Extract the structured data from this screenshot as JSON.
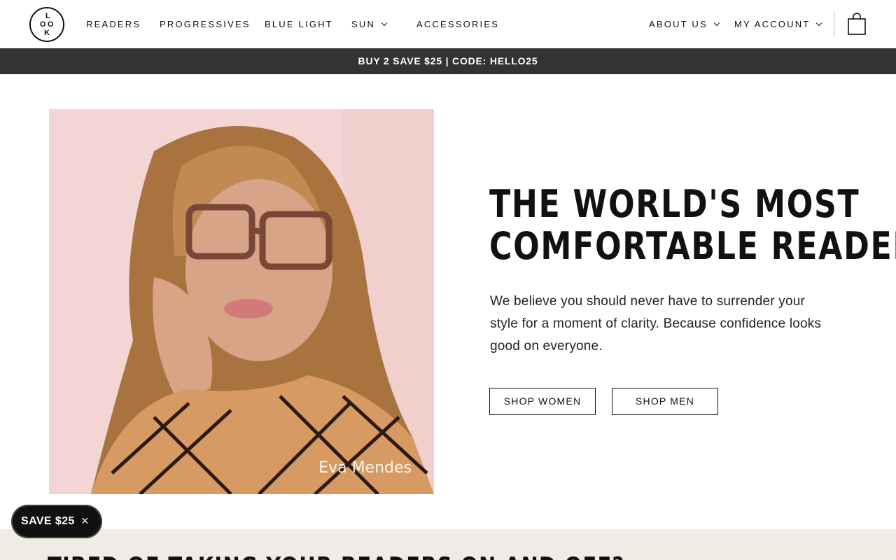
{
  "header": {
    "logo_letters": [
      "L",
      "O",
      "O",
      "K"
    ],
    "nav": [
      {
        "label": "READERS"
      },
      {
        "label": "PROGRESSIVES"
      },
      {
        "label": "BLUE LIGHT"
      },
      {
        "label": "SUN",
        "has_dropdown": true
      },
      {
        "label": "ACCESSORIES"
      }
    ],
    "about_label": "ABOUT US",
    "account_label": "MY ACCOUNT",
    "cart_icon": "shopping-bag-icon"
  },
  "promo": {
    "text": "BUY 2 SAVE $25 | CODE: HELLO25",
    "background": "#333333"
  },
  "hero": {
    "image_caption": "Eva Mendes",
    "headline_line1": "THE WORLD'S MOST",
    "headline_line2": "COMFORTABLE READER",
    "body": "We believe you should never have to surrender your style for a moment of clarity. Because confidence looks good on everyone.",
    "buttons": {
      "women": "SHOP WOMEN",
      "men": "SHOP MEN"
    }
  },
  "lower_section": {
    "title": "TIRED OF TAKING YOUR READERS ON AND OFF?",
    "background": "#efebe5"
  },
  "save_pill": {
    "label": "SAVE $25",
    "close_symbol": "×"
  }
}
